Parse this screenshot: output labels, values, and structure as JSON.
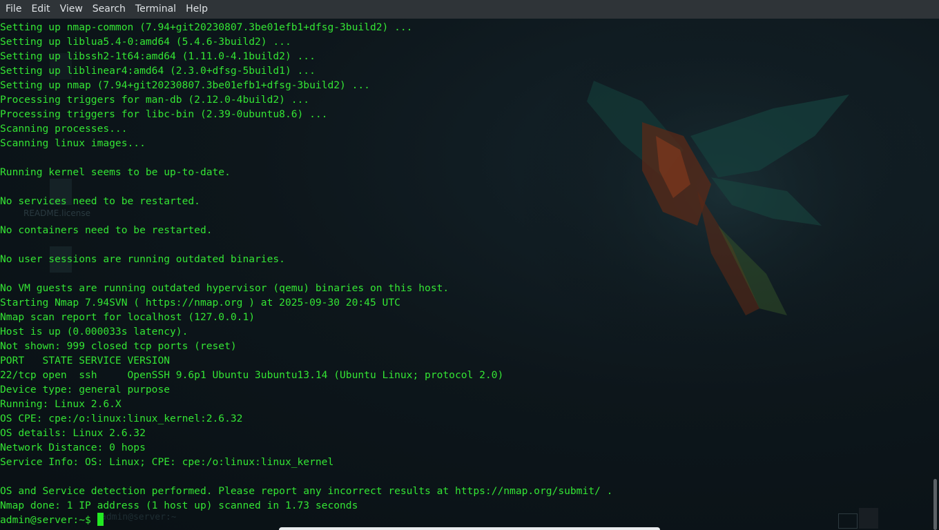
{
  "menubar": {
    "items": [
      "File",
      "Edit",
      "View",
      "Search",
      "Terminal",
      "Help"
    ]
  },
  "desktop": {
    "icon_label": "README.license",
    "ghost_prompt": "admin@server:~"
  },
  "terminal": {
    "lines": [
      "Setting up nmap-common (7.94+git20230807.3be01efb1+dfsg-3build2) ...",
      "Setting up liblua5.4-0:amd64 (5.4.6-3build2) ...",
      "Setting up libssh2-1t64:amd64 (1.11.0-4.1build2) ...",
      "Setting up liblinear4:amd64 (2.3.0+dfsg-5build1) ...",
      "Setting up nmap (7.94+git20230807.3be01efb1+dfsg-3build2) ...",
      "Processing triggers for man-db (2.12.0-4build2) ...",
      "Processing triggers for libc-bin (2.39-0ubuntu8.6) ...",
      "Scanning processes...",
      "Scanning linux images...",
      "",
      "Running kernel seems to be up-to-date.",
      "",
      "No services need to be restarted.",
      "",
      "No containers need to be restarted.",
      "",
      "No user sessions are running outdated binaries.",
      "",
      "No VM guests are running outdated hypervisor (qemu) binaries on this host.",
      "Starting Nmap 7.94SVN ( https://nmap.org ) at 2025-09-30 20:45 UTC",
      "Nmap scan report for localhost (127.0.0.1)",
      "Host is up (0.000033s latency).",
      "Not shown: 999 closed tcp ports (reset)",
      "PORT   STATE SERVICE VERSION",
      "22/tcp open  ssh     OpenSSH 9.6p1 Ubuntu 3ubuntu13.14 (Ubuntu Linux; protocol 2.0)",
      "Device type: general purpose",
      "Running: Linux 2.6.X",
      "OS CPE: cpe:/o:linux:linux_kernel:2.6.32",
      "OS details: Linux 2.6.32",
      "Network Distance: 0 hops",
      "Service Info: OS: Linux; CPE: cpe:/o:linux:linux_kernel",
      "",
      "OS and Service detection performed. Please report any incorrect results at https://nmap.org/submit/ .",
      "Nmap done: 1 IP address (1 host up) scanned in 1.73 seconds"
    ],
    "prompt": "admin@server:~$ ",
    "text_color": "#34e534",
    "background": "#0b1216"
  }
}
